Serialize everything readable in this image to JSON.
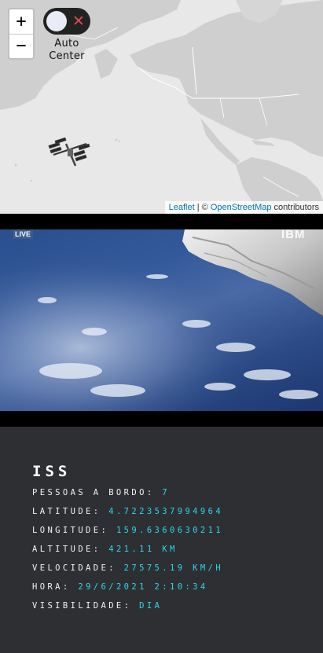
{
  "map": {
    "zoom_in_label": "+",
    "zoom_out_label": "−",
    "auto_center_label": "Auto Center",
    "toggle_off_symbol": "✕",
    "attribution": {
      "leaflet": "Leaflet",
      "separator": " | © ",
      "osm": "OpenStreetMap",
      "contributors": " contributors"
    },
    "colors": {
      "water": "#e8e8e8",
      "land": "#cfcfcf",
      "border": "#ffffff",
      "link": "#0078a8"
    }
  },
  "video": {
    "live_badge": "LIVE",
    "watermark": "IBM"
  },
  "info": {
    "title": "ISS",
    "rows": [
      {
        "key": "PESSOAS A BORDO:",
        "value": "7"
      },
      {
        "key": "LATITUDE:",
        "value": "4.7223537994964"
      },
      {
        "key": "LONGITUDE:",
        "value": "159.6360630211"
      },
      {
        "key": "ALTITUDE:",
        "value": "421.11 KM"
      },
      {
        "key": "VELOCIDADE:",
        "value": "27575.19 KM/H"
      },
      {
        "key": "HORA:",
        "value": "29/6/2021 2:10:34"
      },
      {
        "key": "VISIBILIDADE:",
        "value": "DIA"
      }
    ],
    "colors": {
      "background": "#2d2f33",
      "label": "#f2f2f2",
      "value": "#2fd6ee"
    }
  }
}
